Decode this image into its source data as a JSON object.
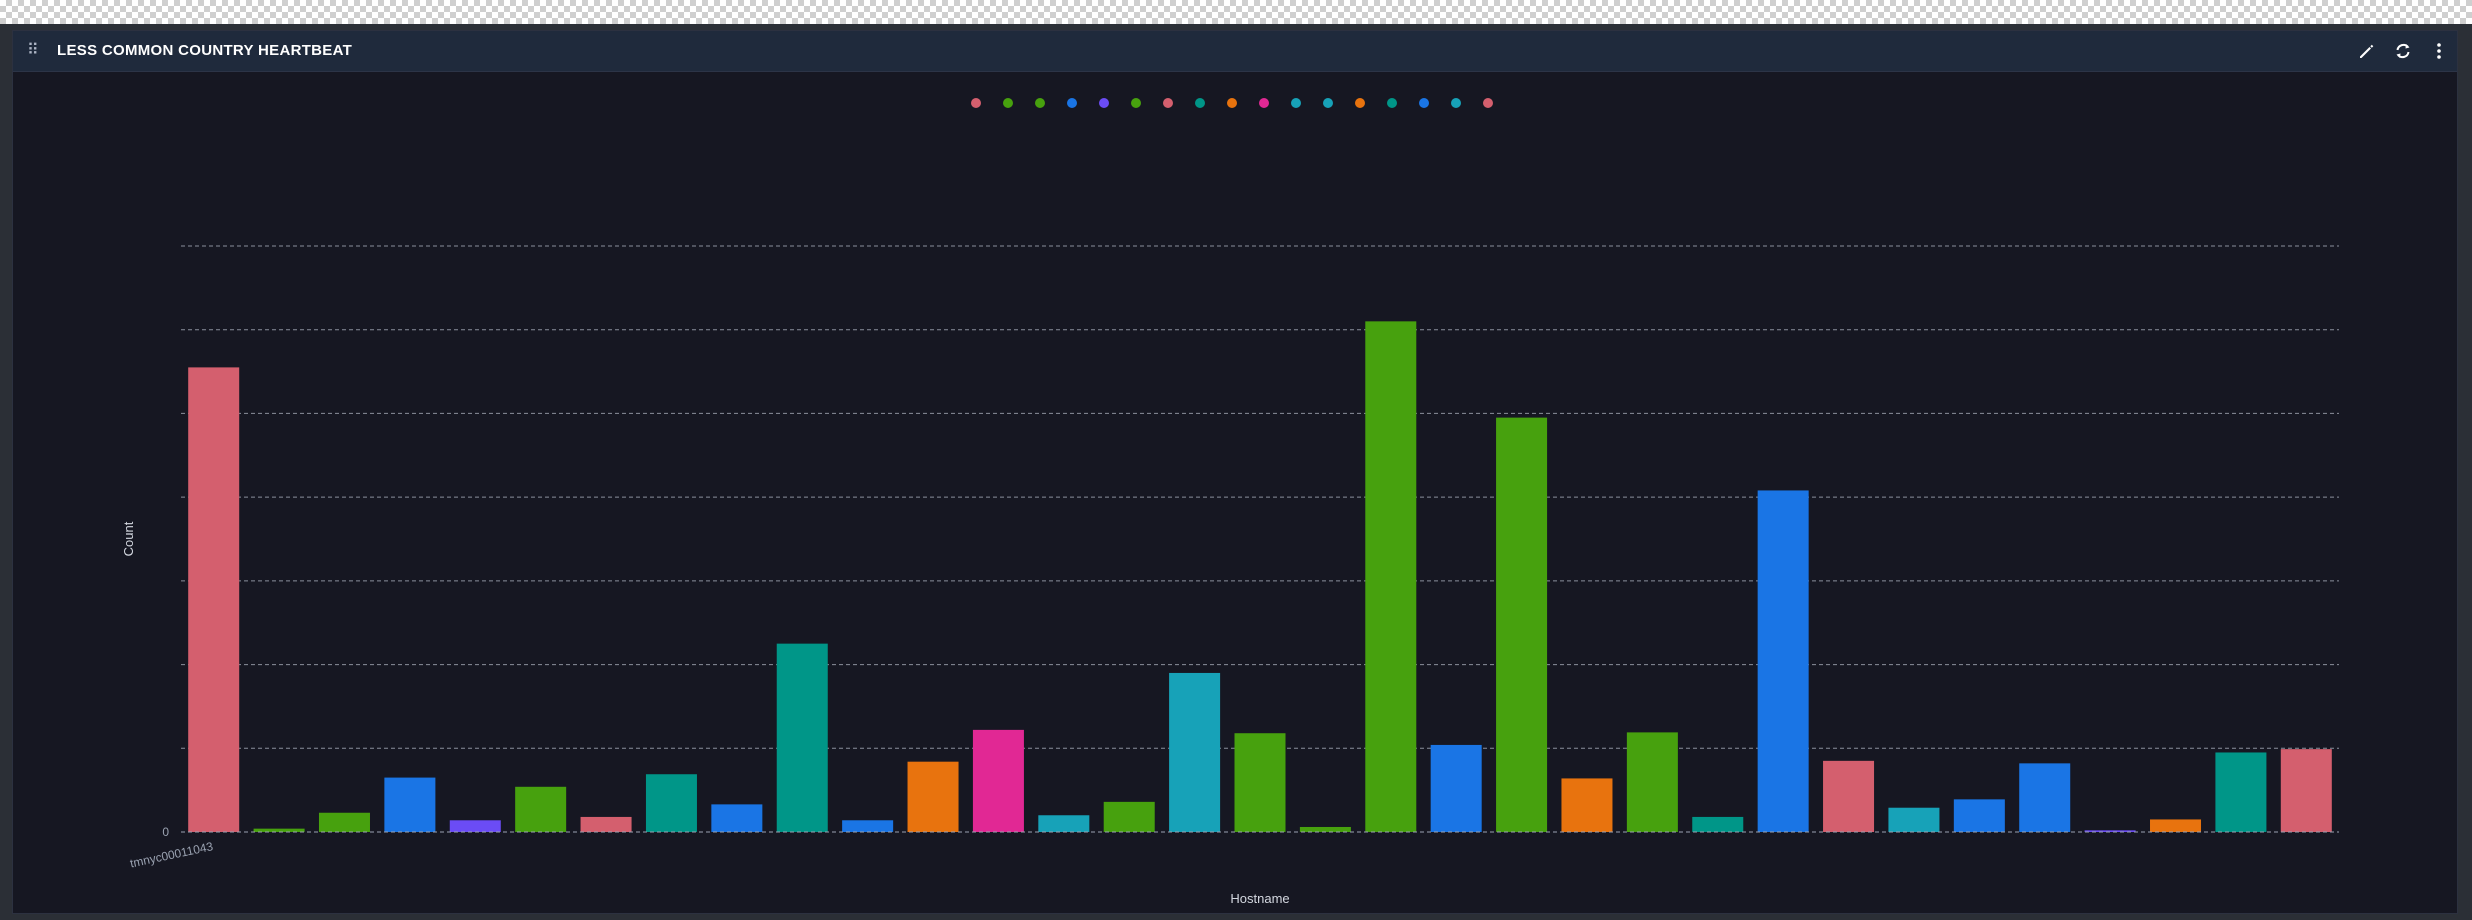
{
  "panel": {
    "title": "LESS COMMON COUNTRY HEARTBEAT",
    "icons": [
      "drag-handle-icon",
      "pencil-icon",
      "refresh-icon",
      "more-vertical-icon"
    ]
  },
  "legend": {
    "placement": "top-center",
    "entries": [
      {
        "label": "",
        "color": "#d45f6e"
      },
      {
        "label": "",
        "color": "#47a10e"
      },
      {
        "label": "",
        "color": "#47a10e"
      },
      {
        "label": "",
        "color": "#1a75e5"
      },
      {
        "label": "",
        "color": "#6b4cf5"
      },
      {
        "label": "",
        "color": "#47a10e"
      },
      {
        "label": "",
        "color": "#d45f6e"
      },
      {
        "label": "",
        "color": "#009688"
      },
      {
        "label": "",
        "color": "#e8730e"
      },
      {
        "label": "",
        "color": "#e12894"
      },
      {
        "label": "",
        "color": "#17a2b8"
      },
      {
        "label": "",
        "color": "#17a2b8"
      },
      {
        "label": "",
        "color": "#e8730e"
      },
      {
        "label": "",
        "color": "#009688"
      },
      {
        "label": "",
        "color": "#1a75e5"
      },
      {
        "label": "",
        "color": "#17a2b8"
      },
      {
        "label": "",
        "color": "#d45f6e"
      }
    ]
  },
  "chart_data": {
    "type": "bar",
    "xlabel": "Hostname",
    "ylabel": "Count",
    "ylim": [
      0,
      7000
    ],
    "yticks": [
      0,
      1000,
      2000,
      3000,
      4000,
      5000,
      6000,
      7000
    ],
    "ytick_labels": [
      "0",
      "",
      "",
      "",
      "",
      "",
      "",
      ""
    ],
    "grid": true,
    "categories": [
      "tmnyc00011043",
      "",
      "",
      "",
      "",
      "",
      "",
      "",
      "",
      "",
      "",
      "",
      "",
      "",
      "",
      "",
      "",
      "",
      "",
      "",
      "",
      "",
      "",
      "",
      "",
      "",
      "",
      "",
      "",
      "",
      "",
      "",
      "",
      ""
    ],
    "xtick_labels": [
      "tmnyc00011043",
      "",
      "",
      "",
      "",
      "",
      "",
      "",
      "",
      "",
      "",
      "",
      "",
      "",
      "",
      "",
      ""
    ],
    "values": [
      5550,
      40,
      230,
      650,
      140,
      540,
      180,
      690,
      330,
      2250,
      140,
      840,
      1220,
      200,
      360,
      1900,
      1180,
      60,
      6100,
      1040,
      4950,
      640,
      1190,
      180,
      4080,
      850,
      290,
      390,
      820,
      20,
      150,
      950,
      990
    ],
    "colors": [
      "#d45f6e",
      "#47a10e",
      "#47a10e",
      "#1a75e5",
      "#6b4cf5",
      "#47a10e",
      "#d45f6e",
      "#009688",
      "#1a75e5",
      "#009688",
      "#1a75e5",
      "#e8730e",
      "#e12894",
      "#17a2b8",
      "#47a10e",
      "#17a2b8",
      "#47a10e",
      "#47a10e",
      "#47a10e",
      "#1a75e5",
      "#47a10e",
      "#e8730e",
      "#47a10e",
      "#009688",
      "#1a75e5",
      "#d45f6e",
      "#17a2b8",
      "#1a75e5",
      "#1a75e5",
      "#6b4cf5",
      "#e8730e",
      "#009688",
      "#d45f6e"
    ]
  }
}
